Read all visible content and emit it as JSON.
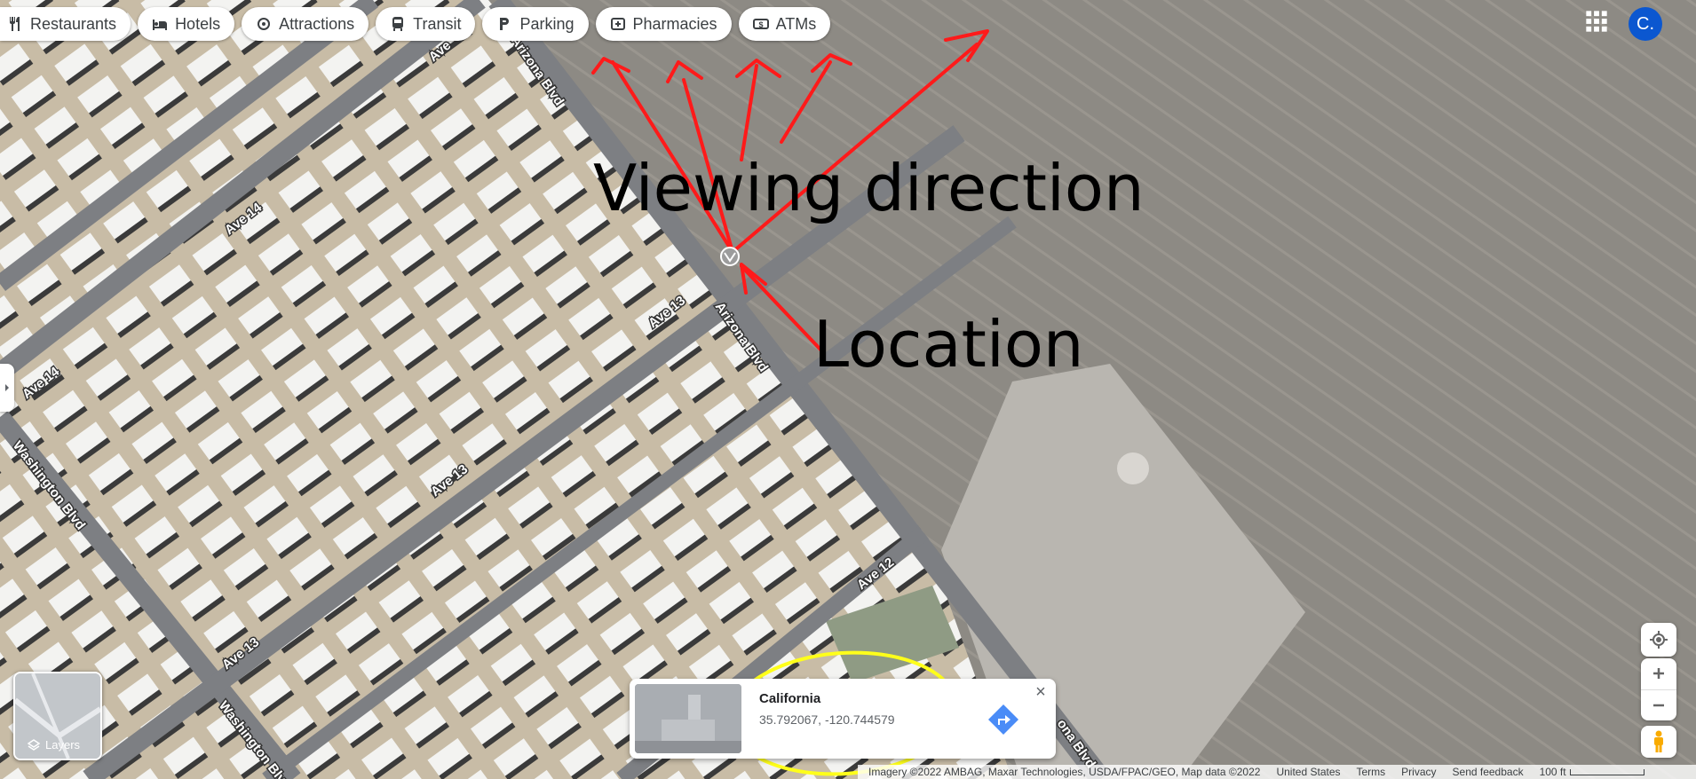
{
  "chips": [
    {
      "label": "Restaurants",
      "icon": "restaurant-icon"
    },
    {
      "label": "Hotels",
      "icon": "hotel-icon"
    },
    {
      "label": "Attractions",
      "icon": "attractions-icon"
    },
    {
      "label": "Transit",
      "icon": "transit-icon"
    },
    {
      "label": "Parking",
      "icon": "parking-icon"
    },
    {
      "label": "Pharmacies",
      "icon": "pharmacy-icon"
    },
    {
      "label": "ATMs",
      "icon": "atm-icon"
    }
  ],
  "account": {
    "initial": "C."
  },
  "layers": {
    "label": "Layers"
  },
  "map_labels": {
    "ave14_a": "Ave 14",
    "ave14_b": "Ave 14",
    "ave13_a": "Ave 13",
    "ave13_b": "Ave 13",
    "ave13_c": "Ave 13",
    "ave12": "Ave 12",
    "ave_top": "Ave",
    "arizona_a": "Arizona Blvd",
    "arizona_b": "Arizona Blvd",
    "arizona_c": "ona Blvd",
    "washington_a": "Washington Blvd",
    "washington_b": "Washington Blv"
  },
  "annotations": {
    "viewing": "Viewing direction",
    "location": "Location"
  },
  "place_card": {
    "title": "California",
    "coords": "35.792067, -120.744579"
  },
  "footer": {
    "attribution": "Imagery ©2022 AMBAG, Maxar Technologies, USDA/FPAC/GEO, Map data ©2022",
    "country": "United States",
    "terms": "Terms",
    "privacy": "Privacy",
    "feedback": "Send feedback",
    "scale": "100 ft"
  },
  "colors": {
    "field": "#8f8b84",
    "lot": "#c9bca7",
    "road": "#7d7f83",
    "annotation_red": "#ff1a1a",
    "highlight_yellow": "#ffff1a",
    "accent": "#0b57d0",
    "directions": "#4a8cf7"
  }
}
